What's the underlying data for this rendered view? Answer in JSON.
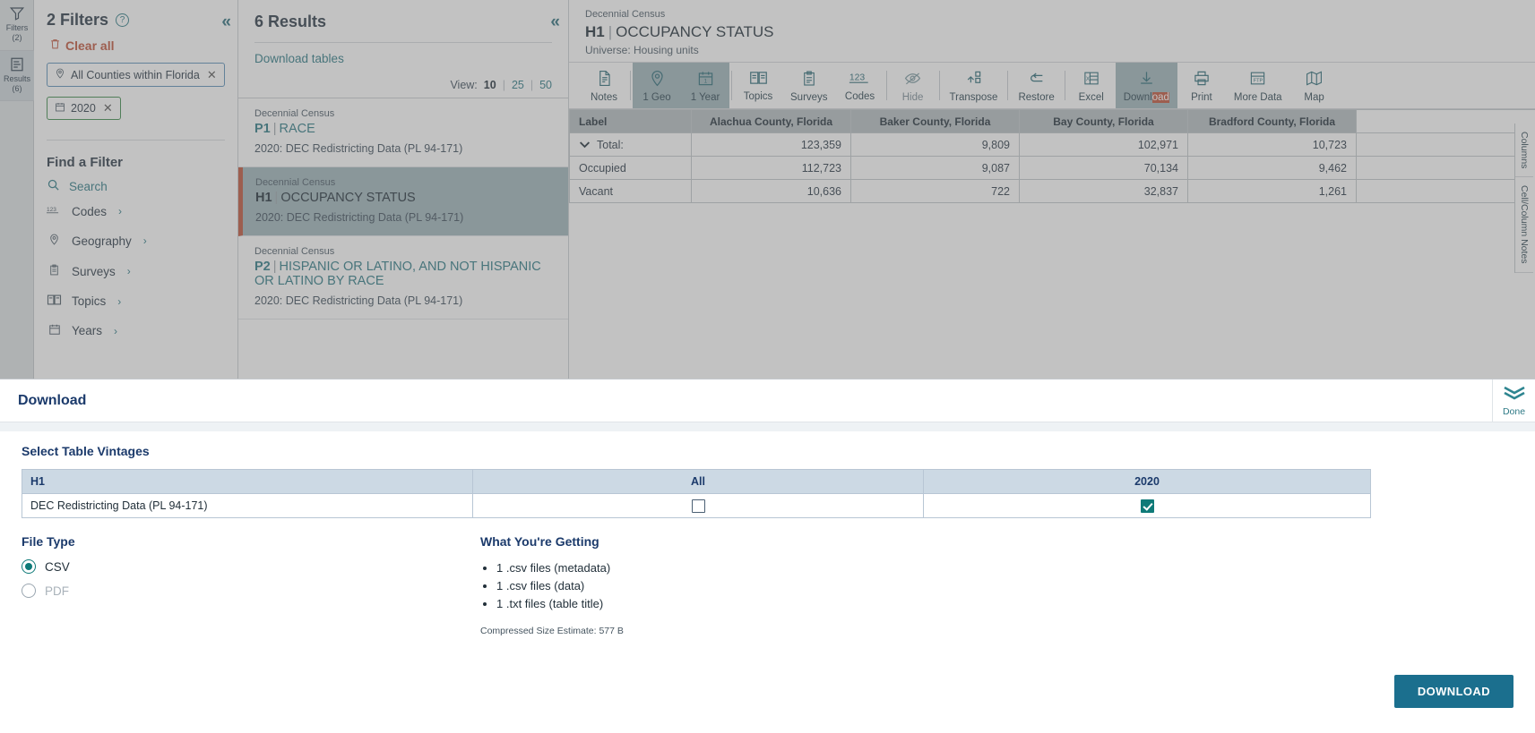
{
  "rail": {
    "items": [
      {
        "label": "Filters",
        "count": "(2)",
        "icon": "funnel-icon",
        "selected": false
      },
      {
        "label": "Results",
        "count": "(6)",
        "icon": "list-icon",
        "selected": true
      }
    ]
  },
  "filters": {
    "title": "2 Filters",
    "help_icon": "question-mark-icon",
    "collapse_icon": "double-chevron-left-icon",
    "clear_all": "Clear all",
    "trash_icon": "trash-icon",
    "chips": [
      {
        "label": "All Counties within Florida",
        "icon": "map-pin-icon",
        "type": "geo"
      },
      {
        "label": "2020",
        "icon": "calendar-icon",
        "type": "year"
      }
    ],
    "find_title": "Find a Filter",
    "search_label": "Search",
    "search_icon": "search-icon",
    "categories": [
      {
        "label": "Codes",
        "icon": "123-icon"
      },
      {
        "label": "Geography",
        "icon": "map-pin-icon"
      },
      {
        "label": "Surveys",
        "icon": "clipboard-icon"
      },
      {
        "label": "Topics",
        "icon": "book-icon"
      },
      {
        "label": "Years",
        "icon": "calendar-icon"
      }
    ]
  },
  "results": {
    "title": "6 Results",
    "collapse_icon": "double-chevron-left-icon",
    "download_tables": "Download tables",
    "view_label": "View:",
    "view_options": [
      "10",
      "25",
      "50"
    ],
    "view_selected": "10",
    "items": [
      {
        "source": "Decennial Census",
        "code": "P1",
        "name": "RACE",
        "meta": "2020: DEC Redistricting Data (PL 94-171)",
        "selected": false
      },
      {
        "source": "Decennial Census",
        "code": "H1",
        "name": "OCCUPANCY STATUS",
        "meta": "2020: DEC Redistricting Data (PL 94-171)",
        "selected": true
      },
      {
        "source": "Decennial Census",
        "code": "P2",
        "name": "HISPANIC OR LATINO, AND NOT HISPANIC OR LATINO BY RACE",
        "meta": "2020: DEC Redistricting Data (PL 94-171)",
        "selected": false
      }
    ]
  },
  "table_view": {
    "source": "Decennial Census",
    "code": "H1",
    "title": "OCCUPANCY STATUS",
    "universe": "Universe: Housing units",
    "toolbar": [
      {
        "label": "Notes",
        "icon": "notes-icon",
        "active": false,
        "disabled": false
      },
      {
        "label": "1 Geo",
        "icon": "map-pin-icon",
        "active": true,
        "disabled": false
      },
      {
        "label": "1 Year",
        "icon": "calendar-icon",
        "active": true,
        "disabled": false
      },
      {
        "label": "Topics",
        "icon": "book-icon",
        "active": false,
        "disabled": false
      },
      {
        "label": "Surveys",
        "icon": "clipboard-icon",
        "active": false,
        "disabled": false
      },
      {
        "label": "Codes",
        "icon": "123-icon",
        "active": false,
        "disabled": false
      },
      {
        "label": "Hide",
        "icon": "eye-slash-icon",
        "active": false,
        "disabled": true
      },
      {
        "label": "Transpose",
        "icon": "transpose-icon",
        "active": false,
        "disabled": false
      },
      {
        "label": "Restore",
        "icon": "undo-icon",
        "active": false,
        "disabled": false
      },
      {
        "label": "Excel",
        "icon": "excel-icon",
        "active": false,
        "disabled": false
      },
      {
        "label": "Download",
        "icon": "download-icon",
        "active": true,
        "disabled": false,
        "selection_prefix": "Downl",
        "selection_highlight": "oad"
      },
      {
        "label": "Print",
        "icon": "printer-icon",
        "active": false,
        "disabled": false
      },
      {
        "label": "More Data",
        "icon": "more-data-icon",
        "active": false,
        "disabled": false
      },
      {
        "label": "Map",
        "icon": "map-icon",
        "active": false,
        "disabled": false
      }
    ],
    "columns": [
      "Label",
      "Alachua County, Florida",
      "Baker County, Florida",
      "Bay County, Florida",
      "Bradford County, Florida"
    ],
    "rows": [
      {
        "label": "Total:",
        "expander": "chevron-down-icon",
        "indent": false,
        "values": [
          "123,359",
          "9,809",
          "102,971",
          "10,723"
        ]
      },
      {
        "label": "Occupied",
        "expander": "",
        "indent": true,
        "values": [
          "112,723",
          "9,087",
          "70,134",
          "9,462"
        ]
      },
      {
        "label": "Vacant",
        "expander": "",
        "indent": true,
        "values": [
          "10,636",
          "722",
          "32,837",
          "1,261"
        ]
      }
    ],
    "side_tabs": [
      "Columns",
      "Cell/Column Notes"
    ]
  },
  "download_modal": {
    "title": "Download",
    "done_label": "Done",
    "done_icon": "double-chevron-down-icon",
    "vintages_section_title": "Select Table Vintages",
    "vintages_columns": [
      "H1",
      "All",
      "2020"
    ],
    "vintages_rows": [
      {
        "name": "DEC Redistricting Data (PL 94-171)",
        "all_checked": false,
        "y2020_checked": true
      }
    ],
    "file_type_title": "File Type",
    "file_types": [
      {
        "label": "CSV",
        "selected": true,
        "disabled": false
      },
      {
        "label": "PDF",
        "selected": false,
        "disabled": true
      }
    ],
    "getting_title": "What You're Getting",
    "getting_items": [
      "1 .csv files (metadata)",
      "1 .csv files (data)",
      "1 .txt files (table title)"
    ],
    "size_estimate": "Compressed Size Estimate: 577 B",
    "download_button": "DOWNLOAD"
  }
}
